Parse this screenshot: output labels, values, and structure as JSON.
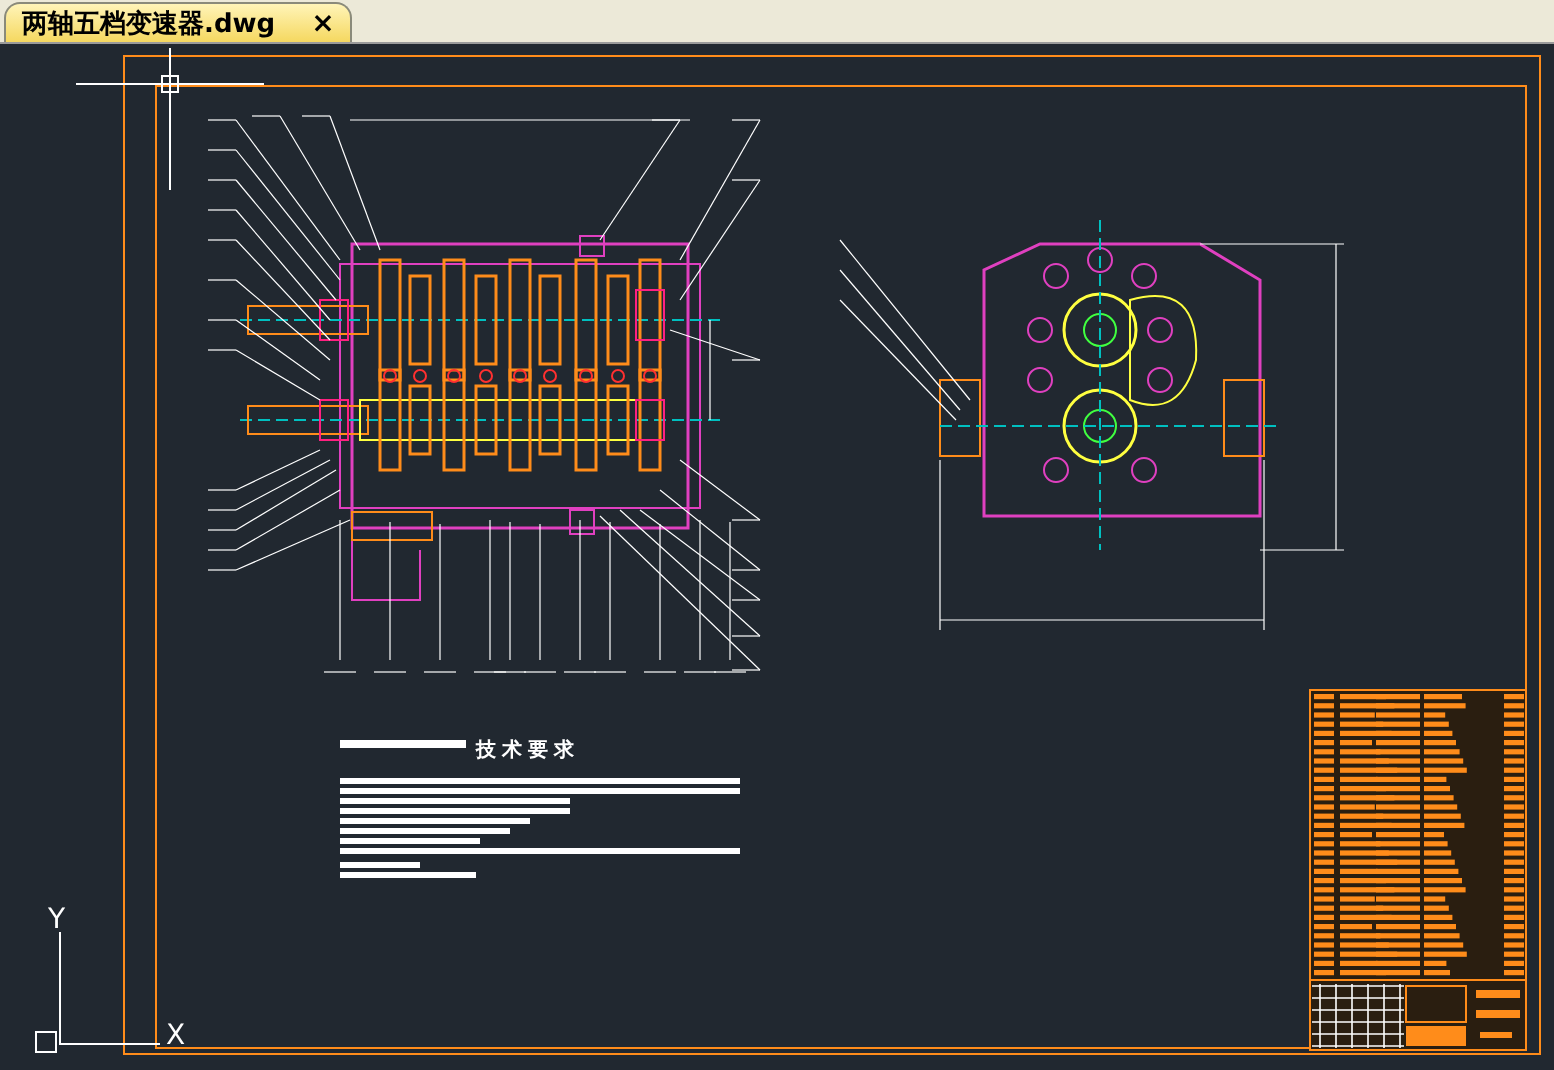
{
  "tab": {
    "title": "两轴五档变速器.dwg",
    "close": "×",
    "selected": true
  },
  "drawing": {
    "notes_heading": "技术要求"
  },
  "ucs": {
    "y_label": "Y",
    "x_label": "X"
  }
}
